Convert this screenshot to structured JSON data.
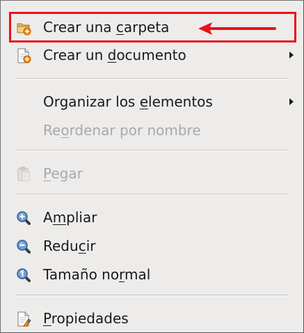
{
  "menu": {
    "items": [
      {
        "label": "Crear una carpeta",
        "icon": "new-folder-icon",
        "enabled": true,
        "highlighted": true,
        "accelerator_index": 10
      },
      {
        "label": "Crear un documento",
        "icon": "new-document-icon",
        "enabled": true,
        "submenu": true,
        "accelerator_index": 9
      },
      {
        "label": "Organizar los elementos",
        "enabled": true,
        "submenu": true,
        "accelerator_index": 14
      },
      {
        "label": "Reordenar por nombre",
        "enabled": false,
        "accelerator_index": 2
      },
      {
        "label": "Pegar",
        "icon": "paste-icon",
        "enabled": false,
        "accelerator_index": 0
      },
      {
        "label": "Ampliar",
        "icon": "zoom-in-icon",
        "enabled": true,
        "accelerator_index": 1
      },
      {
        "label": "Reducir",
        "icon": "zoom-out-icon",
        "enabled": true,
        "accelerator_index": 4
      },
      {
        "label": "Tamaño normal",
        "icon": "zoom-normal-icon",
        "enabled": true,
        "accelerator_index": 9
      },
      {
        "label": "Propiedades",
        "icon": "properties-icon",
        "enabled": true,
        "accelerator_index": 0
      }
    ]
  },
  "colors": {
    "menu_bg": "#edeceb",
    "text": "#1a1a1a",
    "disabled_text": "#a9a9a9",
    "annotation_red": "#e8121a"
  }
}
